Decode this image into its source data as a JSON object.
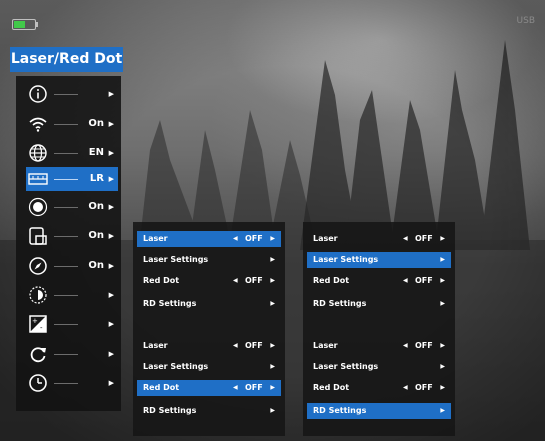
{
  "status": {
    "battery_level": 0.55,
    "left_text": "",
    "right_text": "USB"
  },
  "colors": {
    "accent": "#1f6fc6",
    "battery": "#42c94a"
  },
  "menu": {
    "title": "Laser/Red Dot",
    "items": [
      {
        "icon": "info-icon",
        "value": "",
        "arrow": "▶"
      },
      {
        "icon": "wifi-icon",
        "value": "On",
        "arrow": "▶"
      },
      {
        "icon": "globe-icon",
        "value": "EN",
        "arrow": "▶"
      },
      {
        "icon": "laser-range-icon",
        "value": "LR",
        "arrow": "▶",
        "active": true
      },
      {
        "icon": "brightness-icon",
        "value": "On",
        "arrow": "▶"
      },
      {
        "icon": "picture-in-picture-icon",
        "value": "On",
        "arrow": "▶"
      },
      {
        "icon": "compass-icon",
        "value": "On",
        "arrow": "▶"
      },
      {
        "icon": "contrast-icon",
        "value": "",
        "arrow": "▶"
      },
      {
        "icon": "image-adjust-icon",
        "value": "",
        "arrow": "▶"
      },
      {
        "icon": "refresh-icon",
        "value": "",
        "arrow": "▶"
      },
      {
        "icon": "clock-icon",
        "value": "",
        "arrow": "▶"
      }
    ]
  },
  "panels": [
    {
      "rows": [
        {
          "label": "Laser",
          "left_arrow": "◀",
          "value": "OFF",
          "right_arrow": "▶"
        },
        {
          "label": "Laser Settings",
          "left_arrow": "",
          "value": "",
          "right_arrow": "▶"
        },
        {
          "label": "Red Dot",
          "left_arrow": "◀",
          "value": "OFF",
          "right_arrow": "▶"
        },
        {
          "label": "RD Settings",
          "left_arrow": "",
          "value": "",
          "right_arrow": "▶"
        }
      ],
      "selected": 0
    },
    {
      "rows": [
        {
          "label": "Laser",
          "left_arrow": "◀",
          "value": "OFF",
          "right_arrow": "▶"
        },
        {
          "label": "Laser Settings",
          "left_arrow": "",
          "value": "",
          "right_arrow": "▶"
        },
        {
          "label": "Red Dot",
          "left_arrow": "◀",
          "value": "OFF",
          "right_arrow": "▶"
        },
        {
          "label": "RD Settings",
          "left_arrow": "",
          "value": "",
          "right_arrow": "▶"
        }
      ],
      "selected": 1
    },
    {
      "rows": [
        {
          "label": "Laser",
          "left_arrow": "◀",
          "value": "OFF",
          "right_arrow": "▶"
        },
        {
          "label": "Laser Settings",
          "left_arrow": "",
          "value": "",
          "right_arrow": "▶"
        },
        {
          "label": "Red Dot",
          "left_arrow": "◀",
          "value": "OFF",
          "right_arrow": "▶"
        },
        {
          "label": "RD Settings",
          "left_arrow": "",
          "value": "",
          "right_arrow": "▶"
        }
      ],
      "selected": 2
    },
    {
      "rows": [
        {
          "label": "Laser",
          "left_arrow": "◀",
          "value": "OFF",
          "right_arrow": "▶"
        },
        {
          "label": "Laser Settings",
          "left_arrow": "",
          "value": "",
          "right_arrow": "▶"
        },
        {
          "label": "Red Dot",
          "left_arrow": "◀",
          "value": "OFF",
          "right_arrow": "▶"
        },
        {
          "label": "RD Settings",
          "left_arrow": "",
          "value": "",
          "right_arrow": "▶"
        }
      ],
      "selected": 3
    }
  ]
}
